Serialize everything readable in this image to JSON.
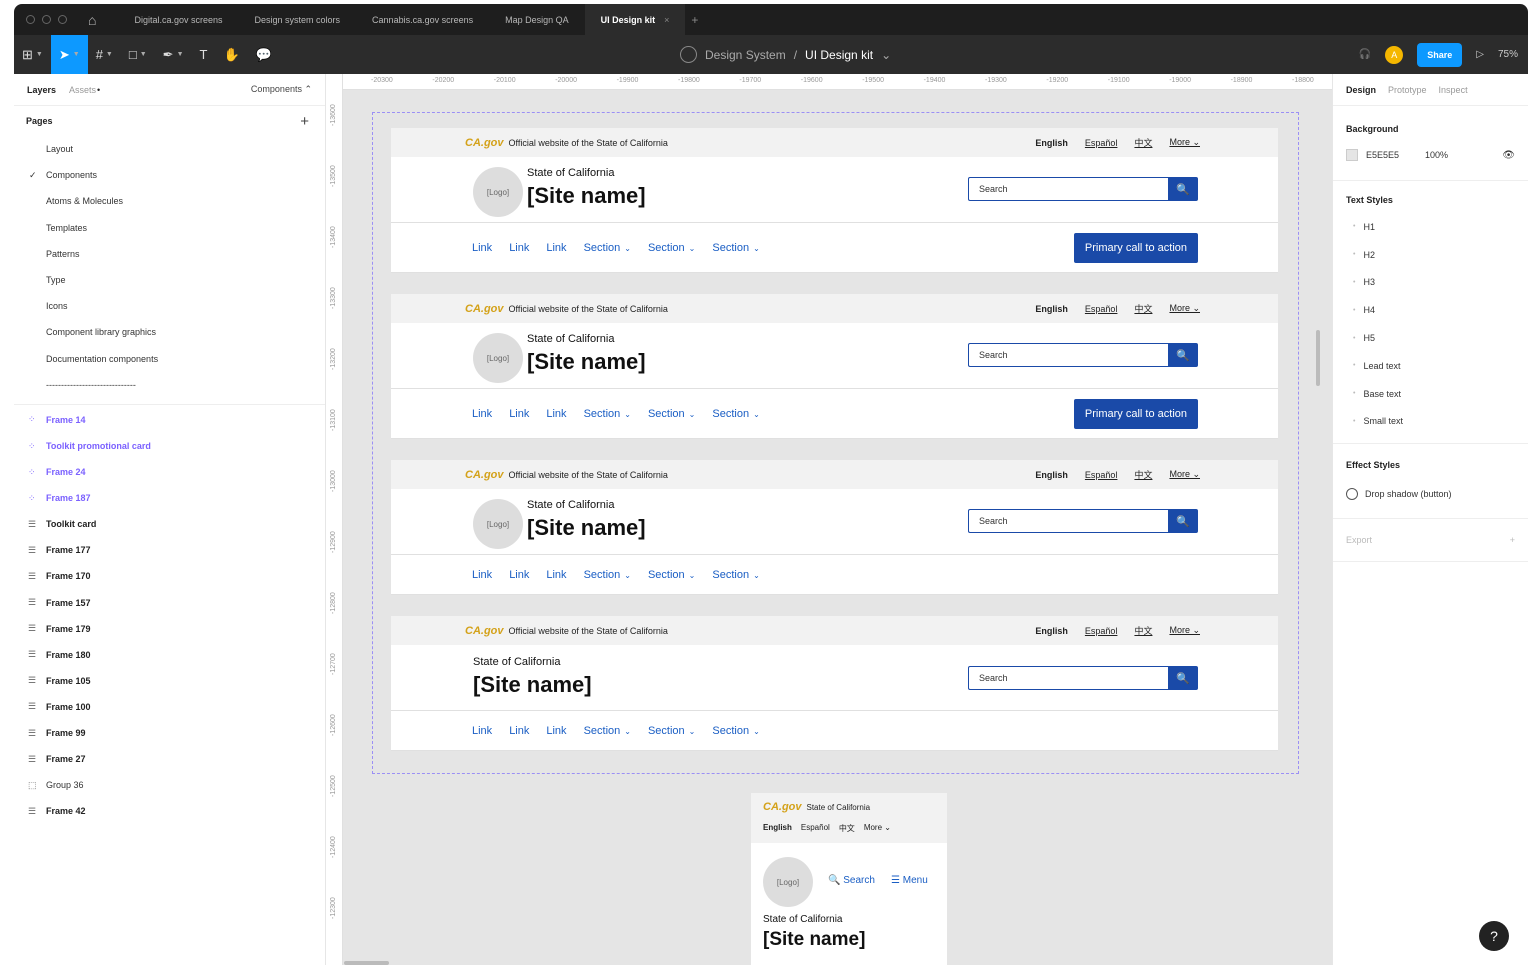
{
  "tabs": [
    "Digital.ca.gov screens",
    "Design system colors",
    "Cannabis.ca.gov screens",
    "Map Design QA",
    "UI Design kit"
  ],
  "active_tab_close": "×",
  "new_tab": "+",
  "breadcrumb": {
    "project": "Design System",
    "sep": "/",
    "file": "UI Design kit",
    "caret": "⌄"
  },
  "toolbar_right": {
    "avatar": "A",
    "share": "Share",
    "zoom": "75%"
  },
  "left_panel": {
    "tabs": {
      "layers": "Layers",
      "assets": "Assets",
      "assets_dot": "•",
      "components": "Components ⌃"
    },
    "pages_title": "Pages",
    "add": "+",
    "check": "✓",
    "pages": [
      "Layout",
      "Components",
      "Atoms & Molecules",
      "Templates",
      "Patterns",
      "Type",
      "Icons",
      "Component library graphics",
      "Documentation components",
      "------------------------------"
    ],
    "layers": [
      {
        "name": "Frame 14",
        "kind": "comp",
        "icon": "⁘"
      },
      {
        "name": "Toolkit promotional card",
        "kind": "comp",
        "icon": "⁘"
      },
      {
        "name": "Frame 24",
        "kind": "comp",
        "icon": "⁘"
      },
      {
        "name": "Frame 187",
        "kind": "comp",
        "icon": "⁘"
      },
      {
        "name": "Toolkit card",
        "kind": "frame",
        "icon": "☰"
      },
      {
        "name": "Frame 177",
        "kind": "frame",
        "icon": "☰"
      },
      {
        "name": "Frame 170",
        "kind": "frame",
        "icon": "☰"
      },
      {
        "name": "Frame 157",
        "kind": "frame",
        "icon": "☰"
      },
      {
        "name": "Frame 179",
        "kind": "frame",
        "icon": "☰"
      },
      {
        "name": "Frame 180",
        "kind": "frame",
        "icon": "☰"
      },
      {
        "name": "Frame 105",
        "kind": "frame",
        "icon": "☰"
      },
      {
        "name": "Frame 100",
        "kind": "frame",
        "icon": "☰"
      },
      {
        "name": "Frame 99",
        "kind": "frame",
        "icon": "☰"
      },
      {
        "name": "Frame 27",
        "kind": "frame",
        "icon": "☰"
      },
      {
        "name": "Group 36",
        "kind": "grp",
        "icon": "⬚"
      },
      {
        "name": "Frame 42",
        "kind": "frame",
        "icon": "☰"
      }
    ]
  },
  "rulers": {
    "x": [
      "-20300",
      "-20200",
      "-20100",
      "-20000",
      "-19900",
      "-19800",
      "-19700",
      "-19600",
      "-19500",
      "-19400",
      "-19300",
      "-19200",
      "-19100",
      "-19000",
      "-18900",
      "-18800"
    ],
    "y": [
      "-13600",
      "-13500",
      "-13400",
      "-13300",
      "-13200",
      "-13100",
      "-13000",
      "-12900",
      "-12800",
      "-12700",
      "-12600",
      "-12500",
      "-12400",
      "-12300"
    ]
  },
  "header": {
    "official": "Official website of the State of California",
    "ca_logo": "CA.gov",
    "lang": {
      "english": "English",
      "espanol": "Español",
      "chinese": "中文",
      "more": "More ⌄"
    },
    "logo": "[Logo]",
    "state": "State of California",
    "site": "[Site name]",
    "search": "Search",
    "search_icon": "🔍",
    "links": [
      "Link",
      "Link",
      "Link"
    ],
    "sections": [
      "Section",
      "Section",
      "Section"
    ],
    "section_caret": "⌄",
    "cta": "Primary call to action"
  },
  "mobile": {
    "state_short": "State of California",
    "search": "Search",
    "menu": "Menu",
    "menu_icon": "☰"
  },
  "right_panel": {
    "tabs": {
      "design": "Design",
      "prototype": "Prototype",
      "inspect": "Inspect"
    },
    "background_title": "Background",
    "bg_hex": "E5E5E5",
    "bg_opacity": "100%",
    "eye": "👁",
    "text_styles_title": "Text Styles",
    "text_styles": [
      "H1",
      "H2",
      "H3",
      "H4",
      "H5",
      "Lead text",
      "Base text",
      "Small text"
    ],
    "bullet": "•",
    "effect_title": "Effect Styles",
    "effect": "Drop shadow (button)",
    "export": "Export",
    "export_add": "+"
  },
  "help": "?"
}
